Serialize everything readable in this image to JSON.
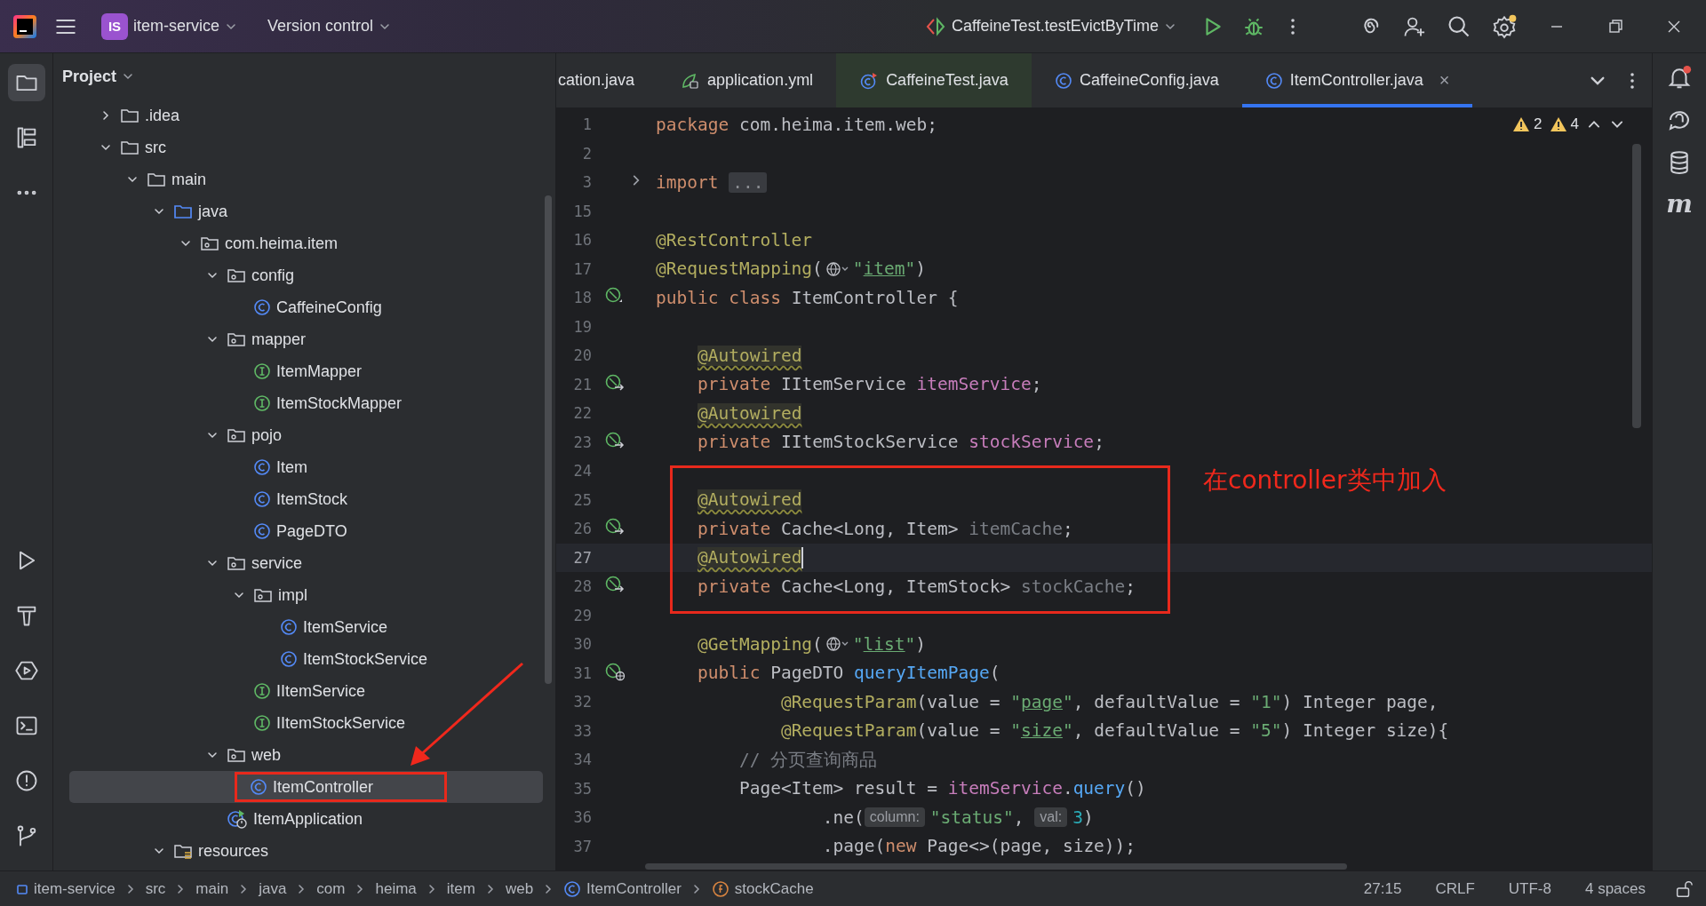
{
  "title_bar": {
    "project_badge": "IS",
    "project": "item-service",
    "vcs": "Version control",
    "run_config": "CaffeineTest.testEvictByTime"
  },
  "left_strip": {
    "top": [
      {
        "kind": "folder",
        "selected": true
      },
      {
        "kind": "structure",
        "selected": false
      },
      {
        "kind": "more",
        "selected": false
      }
    ],
    "bottom": [
      {
        "kind": "run",
        "selected": false
      },
      {
        "kind": "build",
        "selected": false
      },
      {
        "kind": "services",
        "selected": false
      },
      {
        "kind": "terminal",
        "selected": false
      },
      {
        "kind": "problems",
        "selected": false
      },
      {
        "kind": "git",
        "selected": false
      }
    ]
  },
  "project_panel": {
    "title": "Project",
    "tree": [
      {
        "label": ".idea",
        "kind": "folder",
        "expanded": false,
        "selected": false
      },
      {
        "label": "src",
        "kind": "folder",
        "expanded": true,
        "selected": false,
        "children": [
          {
            "label": "main",
            "kind": "folder",
            "expanded": true,
            "selected": false,
            "children": [
              {
                "label": "java",
                "kind": "src-folder",
                "expanded": true,
                "selected": false,
                "children": [
                  {
                    "label": "com.heima.item",
                    "kind": "package",
                    "expanded": true,
                    "selected": false,
                    "children": [
                      {
                        "label": "config",
                        "kind": "package",
                        "expanded": true,
                        "selected": false,
                        "children": [
                          {
                            "label": "CaffeineConfig",
                            "kind": "class",
                            "selected": false
                          }
                        ]
                      },
                      {
                        "label": "mapper",
                        "kind": "package",
                        "expanded": true,
                        "selected": false,
                        "children": [
                          {
                            "label": "ItemMapper",
                            "kind": "interface",
                            "selected": false
                          },
                          {
                            "label": "ItemStockMapper",
                            "kind": "interface",
                            "selected": false
                          }
                        ]
                      },
                      {
                        "label": "pojo",
                        "kind": "package",
                        "expanded": true,
                        "selected": false,
                        "children": [
                          {
                            "label": "Item",
                            "kind": "class",
                            "selected": false
                          },
                          {
                            "label": "ItemStock",
                            "kind": "class",
                            "selected": false
                          },
                          {
                            "label": "PageDTO",
                            "kind": "class",
                            "selected": false
                          }
                        ]
                      },
                      {
                        "label": "service",
                        "kind": "package",
                        "expanded": true,
                        "selected": false,
                        "children": [
                          {
                            "label": "impl",
                            "kind": "package",
                            "expanded": true,
                            "selected": false,
                            "children": [
                              {
                                "label": "ItemService",
                                "kind": "class",
                                "selected": false
                              },
                              {
                                "label": "ItemStockService",
                                "kind": "class",
                                "selected": false
                              }
                            ]
                          },
                          {
                            "label": "IItemService",
                            "kind": "interface",
                            "selected": false
                          },
                          {
                            "label": "IItemStockService",
                            "kind": "interface",
                            "selected": false
                          }
                        ]
                      },
                      {
                        "label": "web",
                        "kind": "package",
                        "expanded": true,
                        "selected": false,
                        "children": [
                          {
                            "label": "ItemController",
                            "kind": "class",
                            "selected": true,
                            "boxed": true
                          }
                        ]
                      },
                      {
                        "label": "ItemApplication",
                        "kind": "app",
                        "selected": false
                      }
                    ]
                  }
                ]
              },
              {
                "label": "resources",
                "kind": "res-folder",
                "expanded": true,
                "selected": false
              }
            ]
          }
        ]
      }
    ]
  },
  "tabs": [
    {
      "label": "cation.java",
      "selected": false
    },
    {
      "label": "application.yml",
      "kind": "yml",
      "selected": false
    },
    {
      "label": "CaffeineTest.java",
      "kind": "test-class",
      "selected": false
    },
    {
      "label": "CaffeineConfig.java",
      "kind": "class",
      "selected": false
    },
    {
      "label": "ItemController.java",
      "kind": "class",
      "selected": true,
      "close": "×"
    }
  ],
  "editor": {
    "warnings": [
      "2",
      "4"
    ],
    "lines": [
      {
        "number": "1",
        "selected": false,
        "tokens": [
          {
            "kind": "kw",
            "text": "package"
          },
          {
            "kind": "plain",
            "text": " com.heima.item.web;"
          }
        ]
      },
      {
        "number": "2",
        "selected": false
      },
      {
        "number": "3",
        "selected": false,
        "folded": true,
        "tokens": [
          {
            "kind": "kw",
            "text": "import "
          },
          {
            "kind": "fold",
            "text": "..."
          }
        ]
      },
      {
        "number": "15",
        "selected": false
      },
      {
        "number": "16",
        "selected": false,
        "tokens": [
          {
            "kind": "ann",
            "text": "@RestController"
          }
        ]
      },
      {
        "number": "17",
        "selected": false,
        "tokens": [
          {
            "kind": "ann",
            "text": "@RequestMapping"
          },
          {
            "kind": "plain",
            "text": "("
          },
          {
            "kind": "globe"
          },
          {
            "kind": "str",
            "text": "\""
          },
          {
            "kind": "link",
            "text": "item"
          },
          {
            "kind": "str",
            "text": "\""
          },
          {
            "kind": "plain",
            "text": ")"
          }
        ]
      },
      {
        "number": "18",
        "selected": false,
        "kind": "bean",
        "tokens": [
          {
            "kind": "kw",
            "text": "public class"
          },
          {
            "kind": "plain",
            "text": " ItemController {"
          }
        ]
      },
      {
        "number": "19",
        "selected": false
      },
      {
        "number": "20",
        "selected": false,
        "tokens": [
          {
            "kind": "ann-marked",
            "text": "    @Autowired"
          }
        ]
      },
      {
        "number": "21",
        "selected": false,
        "kind": "inject",
        "tokens": [
          {
            "kind": "kw",
            "text": "    private"
          },
          {
            "kind": "plain",
            "text": " IItemService "
          },
          {
            "kind": "field",
            "text": "itemService"
          },
          {
            "kind": "plain",
            "text": ";"
          }
        ]
      },
      {
        "number": "22",
        "selected": false,
        "tokens": [
          {
            "kind": "ann-marked",
            "text": "    @Autowired"
          }
        ]
      },
      {
        "number": "23",
        "selected": false,
        "kind": "inject",
        "tokens": [
          {
            "kind": "kw",
            "text": "    private"
          },
          {
            "kind": "plain",
            "text": " IItemStockService "
          },
          {
            "kind": "field",
            "text": "stockService"
          },
          {
            "kind": "plain",
            "text": ";"
          }
        ]
      },
      {
        "number": "24",
        "selected": false
      },
      {
        "number": "25",
        "selected": false,
        "tokens": [
          {
            "kind": "ann-marked",
            "text": "    @Autowired"
          }
        ]
      },
      {
        "number": "26",
        "selected": false,
        "kind": "inject",
        "tokens": [
          {
            "kind": "kw",
            "text": "    private"
          },
          {
            "kind": "plain",
            "text": " Cache<Long, Item> "
          },
          {
            "kind": "unused",
            "text": "itemCache"
          },
          {
            "kind": "plain",
            "text": ";"
          }
        ]
      },
      {
        "number": "27",
        "selected": true,
        "tokens": [
          {
            "kind": "ann-marked",
            "text": "    @Autowired"
          },
          {
            "kind": "caret"
          }
        ]
      },
      {
        "number": "28",
        "selected": false,
        "kind": "inject",
        "tokens": [
          {
            "kind": "kw",
            "text": "    private"
          },
          {
            "kind": "plain",
            "text": " Cache<Long, ItemStock> "
          },
          {
            "kind": "unused",
            "text": "stockCache"
          },
          {
            "kind": "plain",
            "text": ";"
          }
        ]
      },
      {
        "number": "29",
        "selected": false
      },
      {
        "number": "30",
        "selected": false,
        "tokens": [
          {
            "kind": "ann",
            "text": "    @GetMapping"
          },
          {
            "kind": "plain",
            "text": "("
          },
          {
            "kind": "globe"
          },
          {
            "kind": "str",
            "text": "\""
          },
          {
            "kind": "link",
            "text": "list"
          },
          {
            "kind": "str",
            "text": "\""
          },
          {
            "kind": "plain",
            "text": ")"
          }
        ]
      },
      {
        "number": "31",
        "selected": false,
        "kind": "web",
        "tokens": [
          {
            "kind": "kw",
            "text": "    public"
          },
          {
            "kind": "plain",
            "text": " PageDTO "
          },
          {
            "kind": "fn",
            "text": "queryItemPage"
          },
          {
            "kind": "plain",
            "text": "("
          }
        ]
      },
      {
        "number": "32",
        "selected": false,
        "tokens": [
          {
            "kind": "ann",
            "text": "            @RequestParam"
          },
          {
            "kind": "plain",
            "text": "(value = "
          },
          {
            "kind": "str",
            "text": "\""
          },
          {
            "kind": "link",
            "text": "page"
          },
          {
            "kind": "str",
            "text": "\""
          },
          {
            "kind": "plain",
            "text": ", defaultValue = "
          },
          {
            "kind": "str",
            "text": "\"1\""
          },
          {
            "kind": "plain",
            "text": ") Integer page,"
          }
        ]
      },
      {
        "number": "33",
        "selected": false,
        "tokens": [
          {
            "kind": "ann",
            "text": "            @RequestParam"
          },
          {
            "kind": "plain",
            "text": "(value = "
          },
          {
            "kind": "str",
            "text": "\""
          },
          {
            "kind": "link",
            "text": "size"
          },
          {
            "kind": "str",
            "text": "\""
          },
          {
            "kind": "plain",
            "text": ", defaultValue = "
          },
          {
            "kind": "str",
            "text": "\"5\""
          },
          {
            "kind": "plain",
            "text": ") Integer size){"
          }
        ]
      },
      {
        "number": "34",
        "selected": false,
        "tokens": [
          {
            "kind": "comment",
            "text": "        // 分页查询商品"
          }
        ]
      },
      {
        "number": "35",
        "selected": false,
        "tokens": [
          {
            "kind": "plain",
            "text": "        Page<Item> result = "
          },
          {
            "kind": "field",
            "text": "itemService"
          },
          {
            "kind": "plain",
            "text": "."
          },
          {
            "kind": "fn",
            "text": "query"
          },
          {
            "kind": "plain",
            "text": "()"
          }
        ]
      },
      {
        "number": "36",
        "selected": false,
        "tokens": [
          {
            "kind": "plain",
            "text": "                .ne("
          },
          {
            "kind": "hint",
            "text": "column:"
          },
          {
            "kind": "str",
            "text": "\"status\""
          },
          {
            "kind": "plain",
            "text": ", "
          },
          {
            "kind": "hint",
            "text": "val:"
          },
          {
            "kind": "num",
            "text": "3"
          },
          {
            "kind": "plain",
            "text": ")"
          }
        ]
      },
      {
        "number": "37",
        "selected": false,
        "tokens": [
          {
            "kind": "plain",
            "text": "                .page("
          },
          {
            "kind": "kw",
            "text": "new"
          },
          {
            "kind": "plain",
            "text": " Page<>(page, size));"
          }
        ]
      }
    ]
  },
  "annotation": {
    "text": "在controller类中加入"
  },
  "right_strip": [
    {
      "kind": "notifications"
    },
    {
      "kind": "ai-chat"
    },
    {
      "kind": "database"
    },
    {
      "kind": "maven",
      "text": "m"
    }
  ],
  "status_bar": {
    "breadcrumbs": [
      {
        "label": "item-service",
        "kind": "module"
      },
      {
        "label": "src"
      },
      {
        "label": "main"
      },
      {
        "label": "java"
      },
      {
        "label": "com"
      },
      {
        "label": "heima"
      },
      {
        "label": "item"
      },
      {
        "label": "web"
      },
      {
        "label": "ItemController",
        "kind": "class"
      },
      {
        "label": "stockCache",
        "kind": "field"
      }
    ],
    "position": "27:15",
    "line_ending": "CRLF",
    "encoding": "UTF-8",
    "indent": "4 spaces"
  }
}
